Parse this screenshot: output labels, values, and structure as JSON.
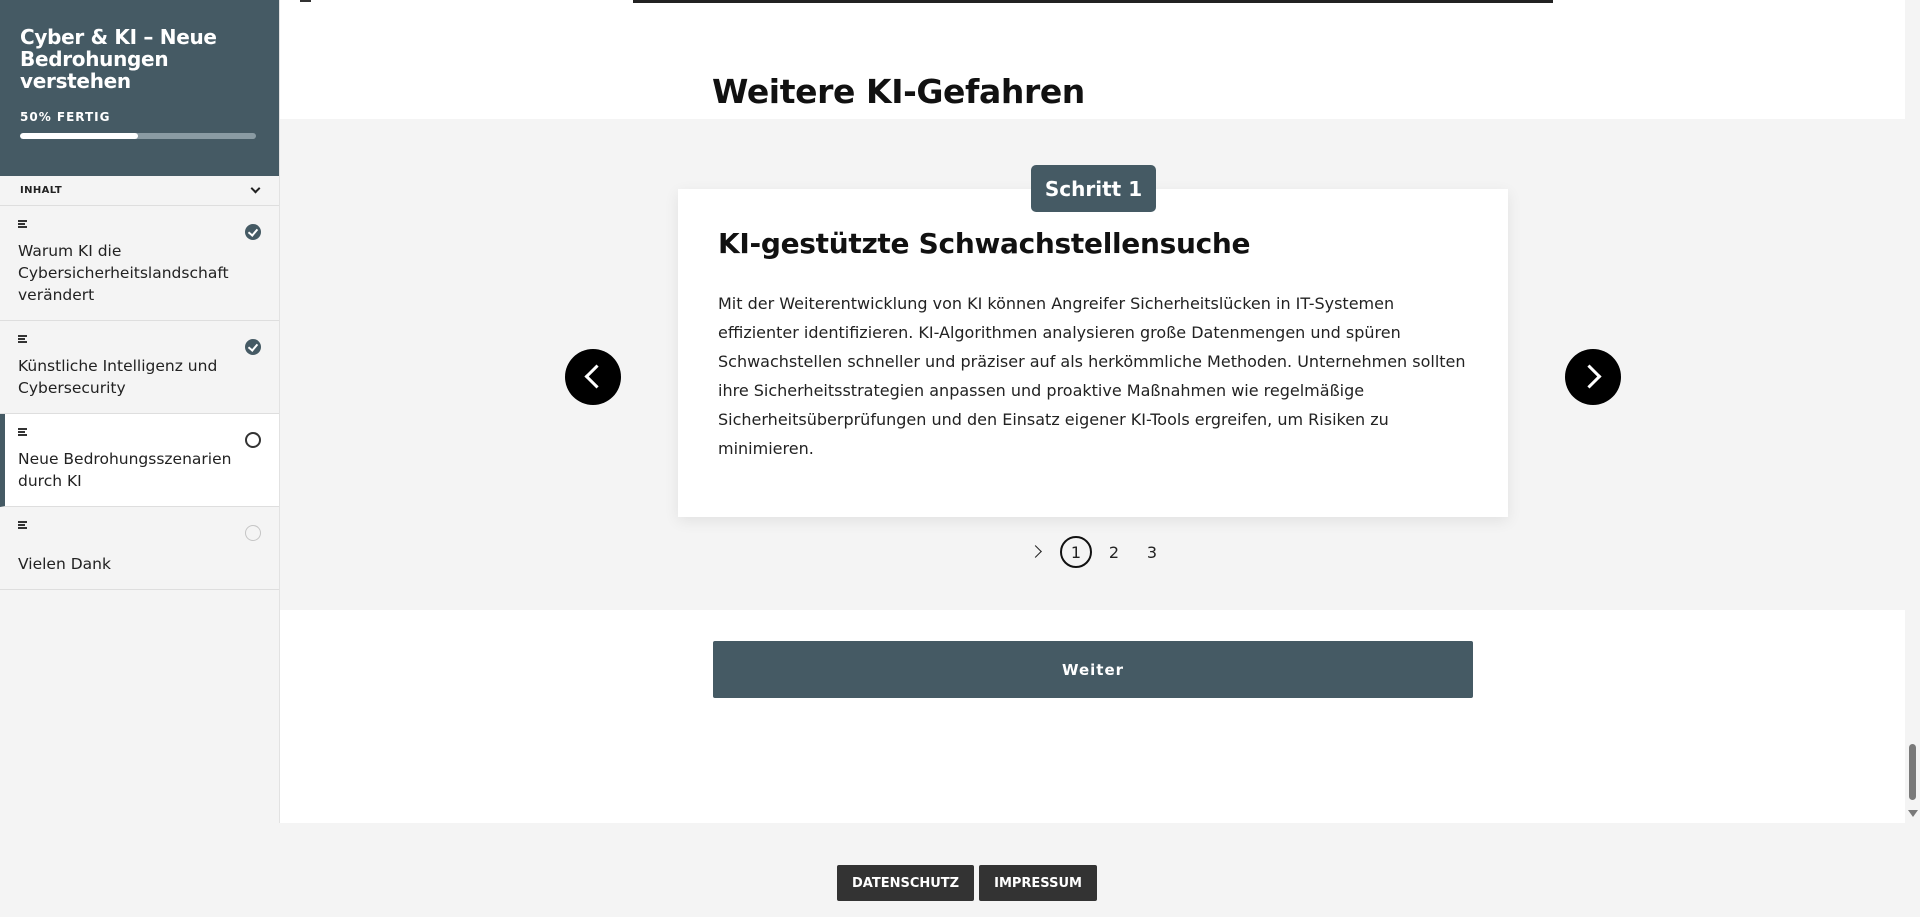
{
  "sidebar": {
    "course_title": "Cyber & KI – Neue Bedrohungen verstehen",
    "progress_label": "50% FERTIG",
    "progress_fraction": 0.5,
    "content_label": "INHALT",
    "lessons": [
      {
        "title": "Warum KI die Cybersicherheitslandschaft verändert",
        "status": "completed"
      },
      {
        "title": "Künstliche Intelligenz und Cybersecurity",
        "status": "completed"
      },
      {
        "title": "Neue Bedrohungsszenarien durch KI",
        "status": "current"
      },
      {
        "title": "Vielen Dank",
        "status": "not-started"
      }
    ]
  },
  "main": {
    "section_title": "Weitere KI-Gefahren",
    "carousel": {
      "step_label": "Schritt 1",
      "card_title": "KI-gestützte Schwachstellensuche",
      "card_body": "Mit der Weiterentwicklung von KI können Angreifer Sicherheitslücken in IT-Systemen effizienter identifizieren. KI-Algorithmen analysieren große Datenmengen und spüren Schwachstellen schneller und präziser auf als herkömmliche Methoden. Unternehmen sollten ihre Sicherheitsstrategien anpassen und proaktive Maßnahmen wie regelmäßige Sicherheitsüberprüfungen und den Einsatz eigener KI-Tools ergreifen, um Risiken zu minimieren.",
      "pages": [
        "1",
        "2",
        "3"
      ],
      "active_page": "1"
    },
    "continue_label": "Weiter"
  },
  "footer": {
    "privacy_label": "DATENSCHUTZ",
    "imprint_label": "IMPRESSUM"
  },
  "colors": {
    "accent": "#455a64",
    "band": "#f4f4f4",
    "footer_button": "#333333"
  }
}
